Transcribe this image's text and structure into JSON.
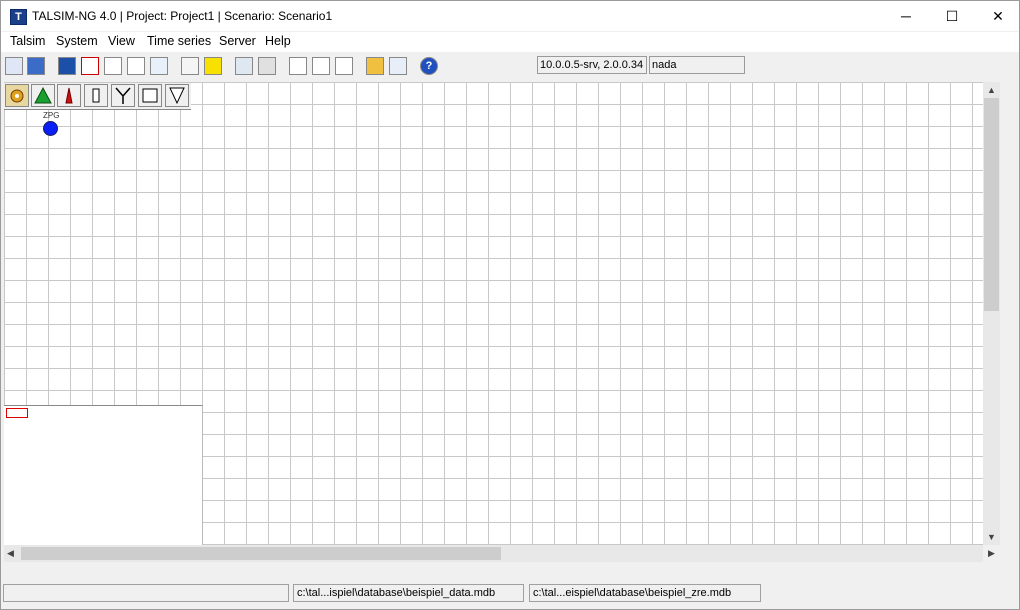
{
  "window": {
    "title": "TALSIM-NG 4.0 | Project: Project1 | Scenario: Scenario1",
    "icon_letter": "T",
    "controls": {
      "minimize": "─",
      "maximize": "☐",
      "close": "✕"
    }
  },
  "menu": {
    "items": [
      {
        "label": "Talsim"
      },
      {
        "label": "System"
      },
      {
        "label": "View"
      },
      {
        "label": "Time series"
      },
      {
        "label": "Server"
      },
      {
        "label": "Help"
      }
    ]
  },
  "toolbar": {
    "server_field": "10.0.0.5-srv, 2.0.0.34",
    "user_field": "nada",
    "help_glyph": "?"
  },
  "palette": {
    "icons": [
      "gear-icon",
      "triangle-green-icon",
      "triangle-red-icon",
      "rectangle-icon",
      "y-junction-icon",
      "square-icon",
      "inverted-triangle-icon"
    ]
  },
  "canvas": {
    "node_label": "ZPG",
    "node_color": "#0a1ff5",
    "grid_color": "#c8c8c8"
  },
  "statusbar": {
    "field1": "",
    "field2": "c:\\tal...ispiel\\database\\beispiel_data.mdb",
    "field3": "c:\\tal...eispiel\\database\\beispiel_zre.mdb"
  }
}
